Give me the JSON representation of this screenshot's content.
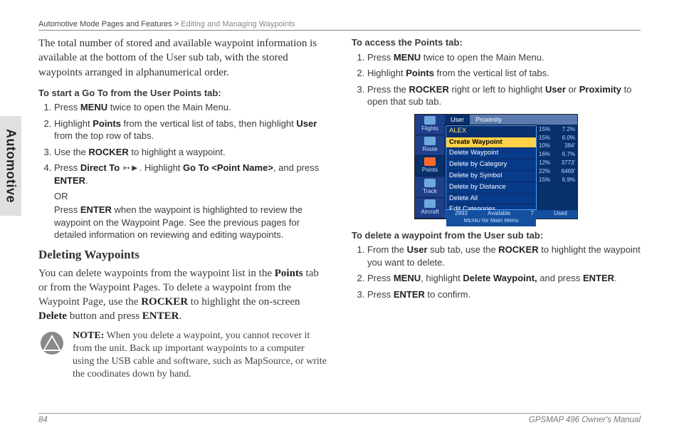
{
  "header": {
    "breadcrumb_main": "Automotive Mode Pages and Features >",
    "breadcrumb_sub": "Editing and Managing Waypoints"
  },
  "sidetab": "Automotive",
  "left": {
    "intro": "The total number of stored and available waypoint information is available at the bottom of the User sub tab, with the stored waypoints arranged in alphanumerical order.",
    "proc1_title": "To start a Go To from the User Points tab:",
    "proc1": {
      "s1a": "Press ",
      "s1b": "MENU",
      "s1c": " twice to open the Main Menu.",
      "s2a": "Highlight ",
      "s2b": "Points",
      "s2c": " from the vertical list of tabs, then highlight ",
      "s2d": "User",
      "s2e": " from the top row of tabs.",
      "s3a": "Use the ",
      "s3b": "ROCKER",
      "s3c": " to highlight a waypoint.",
      "s4a": "Press ",
      "s4b": "Direct To ",
      "s4icon": "➳►",
      "s4c": ". Highlight ",
      "s4d": "Go To <Point Name>",
      "s4e": ", and press ",
      "s4f": "ENTER",
      "s4g": ".",
      "s4or": "OR",
      "s4h": "Press ",
      "s4i": "ENTER",
      "s4j": " when the waypoint is highlighted to review the waypoint on the Waypoint Page. See the previous pages for detailed information on reviewing and editing waypoints."
    },
    "sub_heading": "Deleting Waypoints",
    "sub_body_a": "You can delete waypoints from the waypoint list in the ",
    "sub_body_b": "Points",
    "sub_body_c": " tab or from the Waypoint Pages. To delete a waypoint from the Waypoint Page, use the ",
    "sub_body_d": "ROCKER",
    "sub_body_e": " to highlight the on-screen ",
    "sub_body_f": "Delete",
    "sub_body_g": " button and press ",
    "sub_body_h": "ENTER",
    "sub_body_i": ".",
    "note_label": "NOTE:",
    "note_text": " When you delete a waypoint, you cannot recover it from the unit. Back up important waypoints to a computer using the USB cable and software, such as MapSource, or write the coodinates down by hand."
  },
  "right": {
    "proc2_title": "To access the Points tab:",
    "proc2": {
      "s1a": "Press ",
      "s1b": "MENU",
      "s1c": " twice to open the Main Menu.",
      "s2a": "Highlight ",
      "s2b": "Points",
      "s2c": " from the vertical list of tabs.",
      "s3a": "Press the ",
      "s3b": "ROCKER",
      "s3c": " right or left to highlight ",
      "s3d": "User",
      "s3e": " or ",
      "s3f": "Proximity",
      "s3g": " to open that sub tab."
    },
    "proc3_title": "To delete a waypoint from the User sub tab:",
    "proc3": {
      "s1a": "From the ",
      "s1b": "User",
      "s1c": " sub tab, use the ",
      "s1d": "ROCKER",
      "s1e": " to highlight the waypoint you want to delete.",
      "s2a": "Press ",
      "s2b": "MENU",
      "s2c": ", highlight ",
      "s2d": "Delete Waypoint,",
      "s2e": " and press ",
      "s2f": "ENTER",
      "s2g": ".",
      "s3a": "Press ",
      "s3b": "ENTER",
      "s3c": " to confirm."
    }
  },
  "screenshot": {
    "side_items": [
      "Flights",
      "Route",
      "Points",
      "Track",
      "Aircraft"
    ],
    "tabs": [
      "User",
      "Proximity"
    ],
    "menu_header": "ALEX",
    "menu_items": [
      "Create Waypoint",
      "Delete Waypoint",
      "Delete by Category",
      "Delete by Symbol",
      "Delete by Distance",
      "Delete All",
      "Edit Categories"
    ],
    "menu_footer": "MENU for Main Menu",
    "list_rows": [
      {
        "a": "15%",
        "b": "7.2%"
      },
      {
        "a": "15%",
        "b": "6.0%"
      },
      {
        "a": "10%",
        "b": "384'"
      },
      {
        "a": "16%",
        "b": "6.7%"
      },
      {
        "a": "12%",
        "b": "3773'"
      },
      {
        "a": "22%",
        "b": "6469'"
      },
      {
        "a": "15%",
        "b": "6.9%"
      }
    ],
    "footer_left": "2993",
    "footer_avail": "Available",
    "footer_used_n": "7",
    "footer_used": "Used"
  },
  "footer": {
    "page": "84",
    "manual": "GPSMAP 496 Owner's Manual"
  }
}
